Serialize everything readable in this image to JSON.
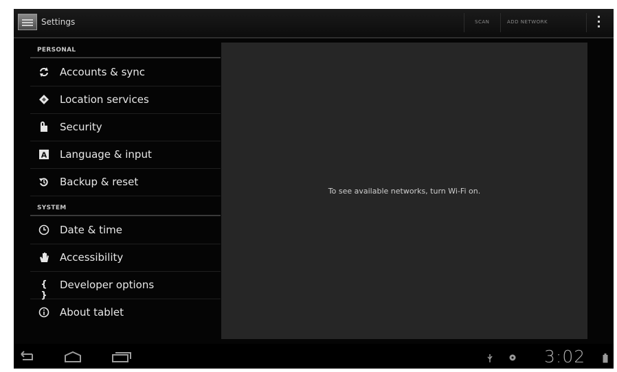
{
  "action_bar": {
    "title": "Settings",
    "actions": [
      "SCAN",
      "ADD NETWORK"
    ]
  },
  "sections": {
    "personal": "PERSONAL",
    "system": "SYSTEM"
  },
  "personal_items": [
    {
      "label": "Accounts & sync",
      "icon": "sync-icon"
    },
    {
      "label": "Location services",
      "icon": "location-icon"
    },
    {
      "label": "Security",
      "icon": "lock-icon"
    },
    {
      "label": "Language & input",
      "icon": "language-icon"
    },
    {
      "label": "Backup & reset",
      "icon": "backup-icon"
    }
  ],
  "system_items": [
    {
      "label": "Date & time",
      "icon": "clock-icon"
    },
    {
      "label": "Accessibility",
      "icon": "hand-icon"
    },
    {
      "label": "Developer options",
      "icon": "braces-icon"
    },
    {
      "label": "About tablet",
      "icon": "info-icon"
    }
  ],
  "detail": {
    "message": "To see available networks, turn Wi-Fi on."
  },
  "status_bar": {
    "time": "3:02"
  },
  "colors": {
    "background": "#050505",
    "panel": "#262626",
    "text": "#e8e8e8"
  }
}
